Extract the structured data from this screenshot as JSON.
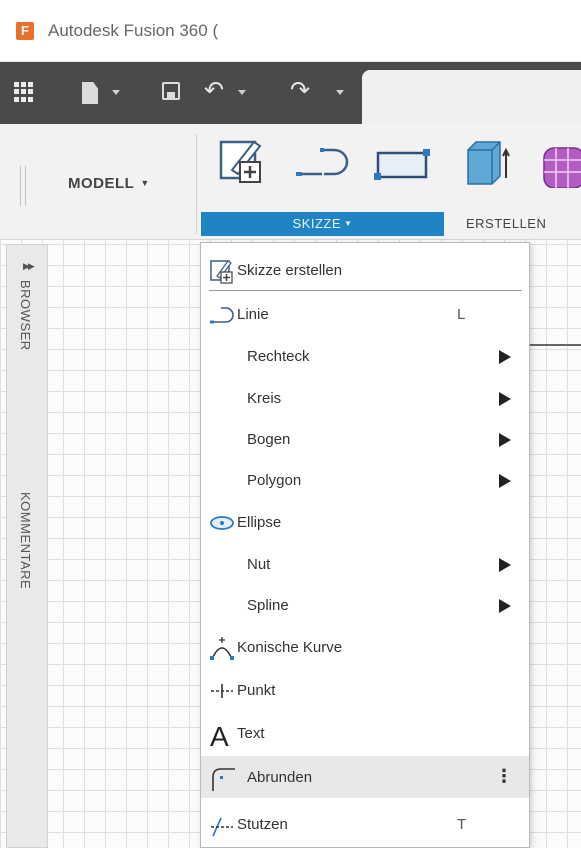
{
  "app": {
    "logo_letter": "F",
    "title": "Autodesk Fusion 360 ("
  },
  "toolbar": {
    "apps_icon": "grid-icon",
    "file_icon": "file-icon",
    "save_icon": "save-icon",
    "undo_icon": "undo-icon",
    "redo_icon": "redo-icon"
  },
  "ribbon": {
    "workspace": "MODELL",
    "tools": [
      "sketch-create-icon",
      "line-icon",
      "rectangle-icon",
      "box-icon",
      "form-icon"
    ],
    "active_group": "SKIZZE",
    "next_group": "ERSTELLEN",
    "accent_color": "#1f84c4"
  },
  "side_panel": {
    "browser": "BROWSER",
    "comments": "KOMMENTARE"
  },
  "menu": {
    "items": [
      {
        "label": "Skizze erstellen",
        "shortcut": "",
        "icon": "sketch-create-icon"
      },
      {
        "label": "Linie",
        "shortcut": "L",
        "icon": "line-icon"
      },
      {
        "label": "Rechteck",
        "shortcut": "",
        "submenu": true
      },
      {
        "label": "Kreis",
        "shortcut": "",
        "submenu": true
      },
      {
        "label": "Bogen",
        "shortcut": "",
        "submenu": true
      },
      {
        "label": "Polygon",
        "shortcut": "",
        "submenu": true
      },
      {
        "label": "Ellipse",
        "shortcut": "",
        "icon": "ellipse-icon"
      },
      {
        "label": "Nut",
        "shortcut": "",
        "submenu": true
      },
      {
        "label": "Spline",
        "shortcut": "",
        "submenu": true
      },
      {
        "label": "Konische Kurve",
        "shortcut": "",
        "icon": "conic-curve-icon"
      },
      {
        "label": "Punkt",
        "shortcut": "",
        "icon": "point-icon"
      },
      {
        "label": "Text",
        "shortcut": "",
        "icon": "text-icon"
      },
      {
        "label": "Abrunden",
        "shortcut": "",
        "icon": "fillet-icon",
        "highlighted": true,
        "more": "⋮"
      },
      {
        "label": "Stutzen",
        "shortcut": "T",
        "icon": "trim-icon"
      }
    ]
  }
}
